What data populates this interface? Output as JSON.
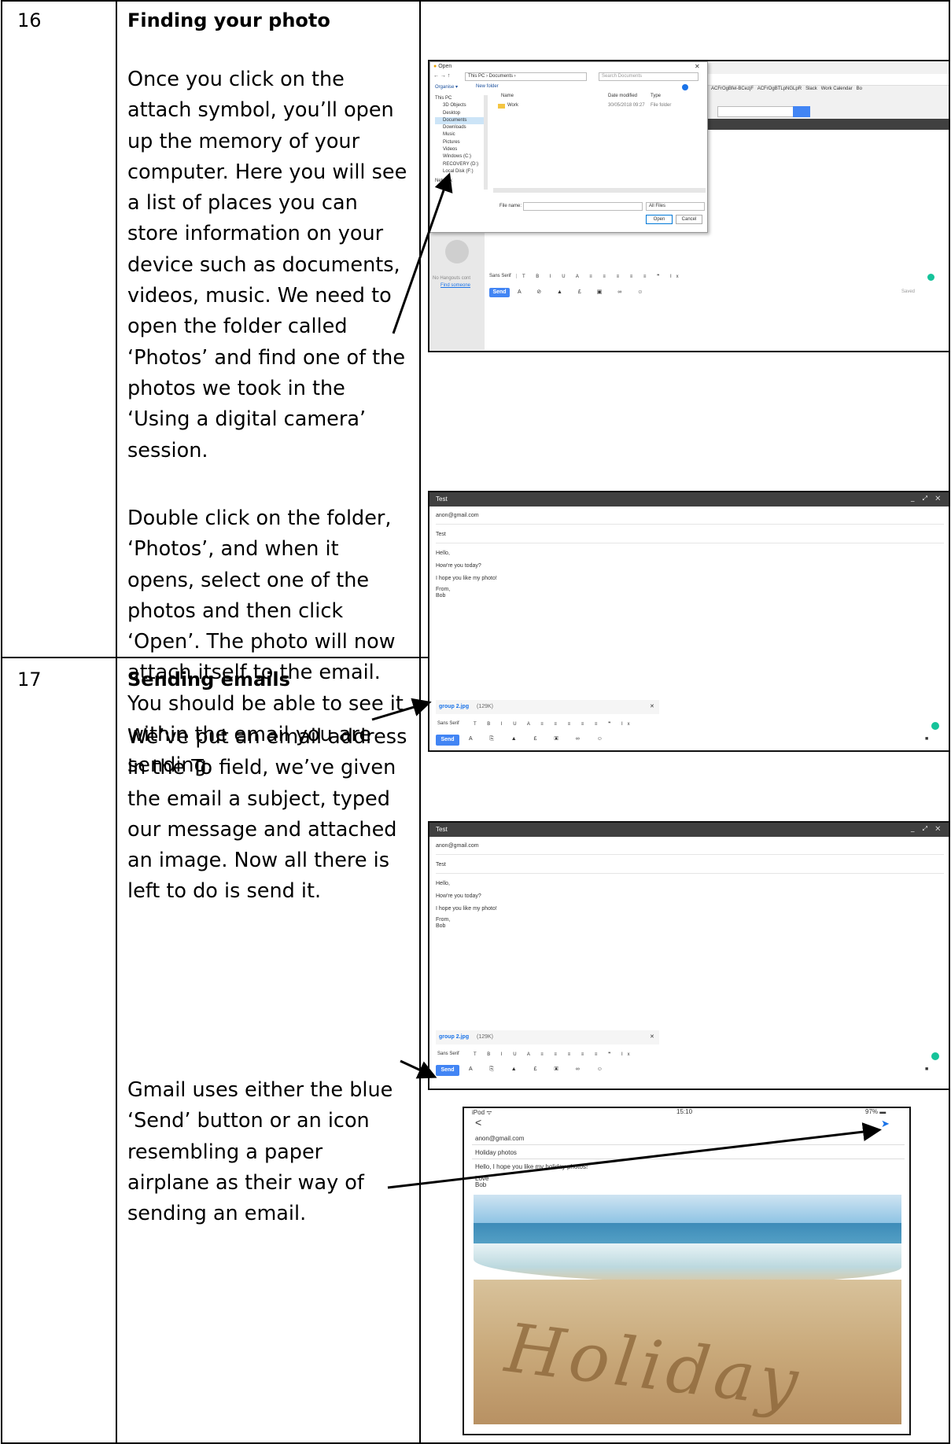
{
  "rows": [
    {
      "number": "16",
      "title": "Finding your photo",
      "paragraphs": [
        "Once you click on the attach symbol, you’ll open up the memory of your computer. Here you will see a list of places you can store information on your device such as documents, videos, music. We need to open the folder called ‘Photos’ and find one of the photos we took in the ‘Using a digital camera’ session.",
        "Double click on the folder, ‘Photos’, and when it opens, select one of the photos and then click ‘Open’. The photo will now attach itself to the email. You should be able to see it within the email you are sending."
      ]
    },
    {
      "number": "17",
      "title": "Sending emails",
      "paragraphs": [
        "We’ve put an email address in the To field, we’ve given the email a subject, typed our message and attached an image. Now all there is left to do is send it.",
        "Gmail uses either the blue ‘Send’ button or an icon resembling a paper airplane as their way of sending an email."
      ]
    }
  ],
  "open_dialog": {
    "title": "Open",
    "path": "This PC › Documents ›",
    "search_placeholder": "Search Documents",
    "organise": "Organise ▾",
    "new_folder": "New folder",
    "tree": [
      "This PC",
      "3D Objects",
      "Desktop",
      "Documents",
      "Downloads",
      "Music",
      "Pictures",
      "Videos",
      "Windows (C:)",
      "RECOVERY (D:)",
      "Local Disk (F:)",
      "Network"
    ],
    "col_name": "Name",
    "col_date": "Date modified",
    "col_type": "Type",
    "file_name": "Work",
    "file_date": "30/05/2018 09:27",
    "file_type": "File folder",
    "filename_label": "File name:",
    "filter": "All Files",
    "open_btn": "Open",
    "cancel_btn": "Cancel",
    "bookmarks": [
      "ACFrOgBfel-BCezjF",
      "ACFrOgBTLpNGLpR",
      "Slack",
      "Work Calendar",
      "Bo"
    ],
    "hangouts_text": "No Hangouts cont",
    "hangouts_link": "Find someone",
    "font_menu": "Sans Serif",
    "send": "Send",
    "saved": "Saved"
  },
  "compose": {
    "window_title": "Test",
    "to": "anon@gmail.com",
    "subject": "Test",
    "body": [
      "Hello,",
      "How're you today?",
      "I hope you like my photo!",
      "From,",
      "Bob"
    ],
    "attachment_name": "group 2.jpg",
    "attachment_size": "(129K)",
    "font_menu": "Sans Serif",
    "send": "Send"
  },
  "mobile": {
    "carrier": "iPod",
    "time": "15:10",
    "battery": "97%",
    "to": "anon@gmail.com",
    "subject": "Holiday photos",
    "body_line": "Hello, I hope you like my holiday photos!",
    "sign_1": "Love",
    "sign_2": "Bob",
    "photo_text": "Holiday"
  },
  "colors": {
    "gmail_blue": "#4285f4",
    "grammarly_green": "#15c39a",
    "dark_bar": "#404040"
  }
}
